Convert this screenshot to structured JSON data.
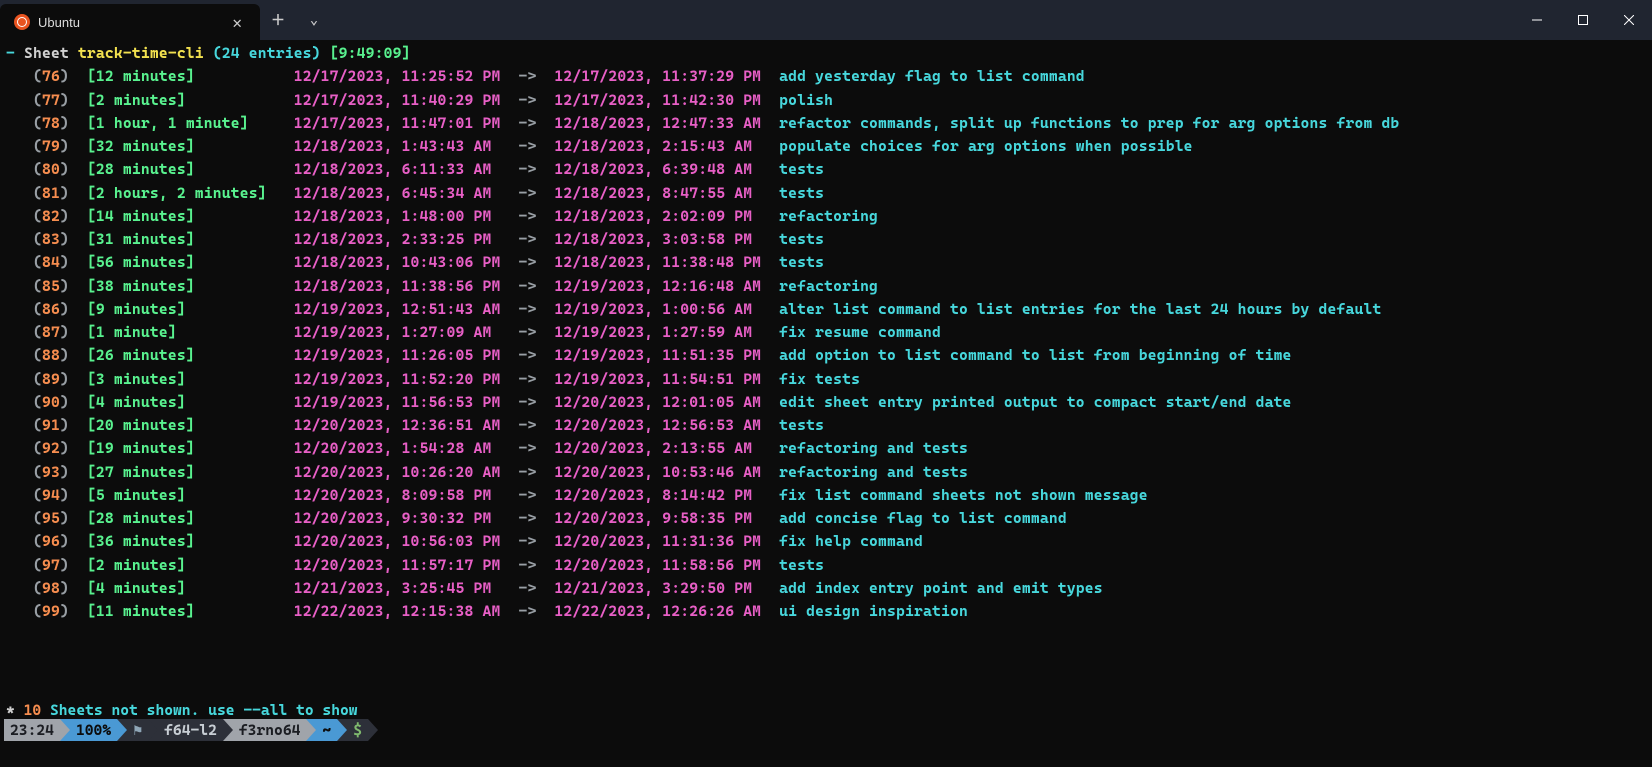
{
  "window": {
    "tab_title": "Ubuntu"
  },
  "header": {
    "prefix": "- ",
    "sheet_label": "Sheet",
    "sheet_name": "track-time-cli",
    "count": "(24 entries)",
    "total": "[9:49:09]"
  },
  "entries": [
    {
      "idx": "76",
      "dur": "12 minutes",
      "start": "12/17/2023, 11:25:52 PM",
      "end": "12/17/2023, 11:37:29 PM",
      "desc": "add yesterday flag to list command"
    },
    {
      "idx": "77",
      "dur": "2 minutes",
      "start": "12/17/2023, 11:40:29 PM",
      "end": "12/17/2023, 11:42:30 PM",
      "desc": "polish"
    },
    {
      "idx": "78",
      "dur": "1 hour, 1 minute",
      "start": "12/17/2023, 11:47:01 PM",
      "end": "12/18/2023, 12:47:33 AM",
      "desc": "refactor commands, split up functions to prep for arg options from db"
    },
    {
      "idx": "79",
      "dur": "32 minutes",
      "start": "12/18/2023, 1:43:43 AM",
      "end": "12/18/2023, 2:15:43 AM",
      "desc": "populate choices for arg options when possible"
    },
    {
      "idx": "80",
      "dur": "28 minutes",
      "start": "12/18/2023, 6:11:33 AM",
      "end": "12/18/2023, 6:39:48 AM",
      "desc": "tests"
    },
    {
      "idx": "81",
      "dur": "2 hours, 2 minutes",
      "start": "12/18/2023, 6:45:34 AM",
      "end": "12/18/2023, 8:47:55 AM",
      "desc": "tests"
    },
    {
      "idx": "82",
      "dur": "14 minutes",
      "start": "12/18/2023, 1:48:00 PM",
      "end": "12/18/2023, 2:02:09 PM",
      "desc": "refactoring"
    },
    {
      "idx": "83",
      "dur": "31 minutes",
      "start": "12/18/2023, 2:33:25 PM",
      "end": "12/18/2023, 3:03:58 PM",
      "desc": "tests"
    },
    {
      "idx": "84",
      "dur": "56 minutes",
      "start": "12/18/2023, 10:43:06 PM",
      "end": "12/18/2023, 11:38:48 PM",
      "desc": "tests"
    },
    {
      "idx": "85",
      "dur": "38 minutes",
      "start": "12/18/2023, 11:38:56 PM",
      "end": "12/19/2023, 12:16:48 AM",
      "desc": "refactoring"
    },
    {
      "idx": "86",
      "dur": "9 minutes",
      "start": "12/19/2023, 12:51:43 AM",
      "end": "12/19/2023, 1:00:56 AM",
      "desc": "alter list command to list entries for the last 24 hours by default"
    },
    {
      "idx": "87",
      "dur": "1 minute",
      "start": "12/19/2023, 1:27:09 AM",
      "end": "12/19/2023, 1:27:59 AM",
      "desc": "fix resume command"
    },
    {
      "idx": "88",
      "dur": "26 minutes",
      "start": "12/19/2023, 11:26:05 PM",
      "end": "12/19/2023, 11:51:35 PM",
      "desc": "add option to list command to list from beginning of time"
    },
    {
      "idx": "89",
      "dur": "3 minutes",
      "start": "12/19/2023, 11:52:20 PM",
      "end": "12/19/2023, 11:54:51 PM",
      "desc": "fix tests"
    },
    {
      "idx": "90",
      "dur": "4 minutes",
      "start": "12/19/2023, 11:56:53 PM",
      "end": "12/20/2023, 12:01:05 AM",
      "desc": "edit sheet entry printed output to compact start/end date"
    },
    {
      "idx": "91",
      "dur": "20 minutes",
      "start": "12/20/2023, 12:36:51 AM",
      "end": "12/20/2023, 12:56:53 AM",
      "desc": "tests"
    },
    {
      "idx": "92",
      "dur": "19 minutes",
      "start": "12/20/2023, 1:54:28 AM",
      "end": "12/20/2023, 2:13:55 AM",
      "desc": "refactoring and tests"
    },
    {
      "idx": "93",
      "dur": "27 minutes",
      "start": "12/20/2023, 10:26:20 AM",
      "end": "12/20/2023, 10:53:46 AM",
      "desc": "refactoring and tests"
    },
    {
      "idx": "94",
      "dur": "5 minutes",
      "start": "12/20/2023, 8:09:58 PM",
      "end": "12/20/2023, 8:14:42 PM",
      "desc": "fix list command sheets not shown message"
    },
    {
      "idx": "95",
      "dur": "28 minutes",
      "start": "12/20/2023, 9:30:32 PM",
      "end": "12/20/2023, 9:58:35 PM",
      "desc": "add concise flag to list command"
    },
    {
      "idx": "96",
      "dur": "36 minutes",
      "start": "12/20/2023, 10:56:03 PM",
      "end": "12/20/2023, 11:31:36 PM",
      "desc": "fix help command"
    },
    {
      "idx": "97",
      "dur": "2 minutes",
      "start": "12/20/2023, 11:57:17 PM",
      "end": "12/20/2023, 11:58:56 PM",
      "desc": "tests"
    },
    {
      "idx": "98",
      "dur": "4 minutes",
      "start": "12/21/2023, 3:25:45 PM",
      "end": "12/21/2023, 3:29:50 PM",
      "desc": "add index entry point and emit types"
    },
    {
      "idx": "99",
      "dur": "11 minutes",
      "start": "12/22/2023, 12:15:38 AM",
      "end": "12/22/2023, 12:26:26 AM",
      "desc": "ui design inspiration"
    }
  ],
  "footer": {
    "star": "*",
    "count": "10",
    "msg": "Sheets not shown. use --all to show"
  },
  "statusbar": {
    "time": "23:24",
    "pct": "100%",
    "flag": "⚑",
    "host": "f64-l2",
    "user": "f3rno64",
    "path": "~",
    "prompt": "$"
  },
  "arrow": "->",
  "sep": "▶"
}
